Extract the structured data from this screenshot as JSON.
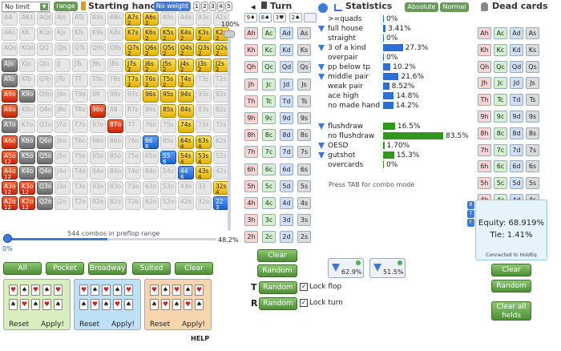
{
  "header": {
    "limit_select": "No limit",
    "range_label": "range",
    "starting_hand": "Starting hand",
    "no_weight": "No weight",
    "tabs": [
      "1",
      "2",
      "3",
      "4",
      "5"
    ],
    "turn": "Turn",
    "statistics": "Statistics",
    "absolute": "Absolute",
    "normal": "Normal",
    "dead_cards": "Dead cards"
  },
  "range": {
    "percent": "100%",
    "combos": "544 combos in preflop range",
    "slider_value": "48.2%",
    "slider_start": "0%",
    "rows": [
      [
        [
          "AA",
          "",
          "g"
        ],
        [
          "AKs",
          "",
          "g"
        ],
        [
          "AQs",
          "",
          "g"
        ],
        [
          "AJs",
          "",
          "g"
        ],
        [
          "ATs",
          "",
          "g"
        ],
        [
          "A9s",
          "",
          "g"
        ],
        [
          "A8s",
          "",
          "g"
        ],
        [
          "A7s",
          "2",
          "y"
        ],
        [
          "A6s",
          "2",
          "y"
        ],
        [
          "A5s",
          "",
          "g"
        ],
        [
          "A4s",
          "",
          "g"
        ],
        [
          "A3s",
          "",
          "g"
        ],
        [
          "A2s",
          "",
          "g"
        ]
      ],
      [
        [
          "AKo",
          "",
          "g"
        ],
        [
          "KK",
          "",
          "g"
        ],
        [
          "KQs",
          "",
          "g"
        ],
        [
          "KJs",
          "",
          "g"
        ],
        [
          "KTs",
          "",
          "g"
        ],
        [
          "K9s",
          "",
          "g"
        ],
        [
          "K8s",
          "",
          "g"
        ],
        [
          "K7s",
          "",
          "y"
        ],
        [
          "K6s",
          "2",
          "y"
        ],
        [
          "K5s",
          "2",
          "y"
        ],
        [
          "K4s",
          "2",
          "y"
        ],
        [
          "K3s",
          "2",
          "y"
        ],
        [
          "K2s",
          "2",
          "y"
        ]
      ],
      [
        [
          "AQo",
          "",
          "g"
        ],
        [
          "KQo",
          "",
          "g"
        ],
        [
          "QQ",
          "",
          "g"
        ],
        [
          "QJs",
          "",
          "g"
        ],
        [
          "QTs",
          "",
          "g"
        ],
        [
          "Q9s",
          "",
          "g"
        ],
        [
          "Q8s",
          "",
          "g"
        ],
        [
          "Q7s",
          "2",
          "y"
        ],
        [
          "Q6s",
          "2",
          "y"
        ],
        [
          "Q5s",
          "2",
          "y"
        ],
        [
          "Q4s",
          "2",
          "y"
        ],
        [
          "Q3s",
          "2",
          "y"
        ],
        [
          "Q2s",
          "2",
          "y"
        ]
      ],
      [
        [
          "AJo",
          "",
          "d"
        ],
        [
          "KJo",
          "",
          "g"
        ],
        [
          "QJo",
          "",
          "g"
        ],
        [
          "JJ",
          "",
          "g"
        ],
        [
          "JTs",
          "",
          "g"
        ],
        [
          "J9s",
          "",
          "g"
        ],
        [
          "J8s",
          "",
          "g"
        ],
        [
          "J7s",
          "2",
          "y"
        ],
        [
          "J6s",
          "2",
          "y"
        ],
        [
          "J5s",
          "2",
          "y"
        ],
        [
          "J4s",
          "2",
          "y"
        ],
        [
          "J3s",
          "2",
          "y"
        ],
        [
          "J2s",
          "2",
          "y"
        ]
      ],
      [
        [
          "ATo",
          "",
          "d"
        ],
        [
          "KTo",
          "",
          "g"
        ],
        [
          "QTo",
          "",
          "g"
        ],
        [
          "JTo",
          "",
          "g"
        ],
        [
          "TT",
          "",
          "g"
        ],
        [
          "T9s",
          "",
          "g"
        ],
        [
          "T8s",
          "",
          "g"
        ],
        [
          "T7s",
          "2",
          "y"
        ],
        [
          "T6s",
          "2",
          "y"
        ],
        [
          "T5s",
          "2",
          "y"
        ],
        [
          "T4s",
          "2",
          "y"
        ],
        [
          "T3s",
          "",
          "g"
        ],
        [
          "T2s",
          "",
          "g"
        ]
      ],
      [
        [
          "A9o",
          "",
          "r"
        ],
        [
          "K9o",
          "",
          "d"
        ],
        [
          "Q9o",
          "",
          "g"
        ],
        [
          "J9o",
          "",
          "g"
        ],
        [
          "T9o",
          "",
          "g"
        ],
        [
          "99",
          "",
          "g"
        ],
        [
          "98s",
          "",
          "g"
        ],
        [
          "97s",
          "",
          "g"
        ],
        [
          "96s",
          "",
          "y"
        ],
        [
          "95s",
          "",
          "y"
        ],
        [
          "94s",
          "",
          "y"
        ],
        [
          "93s",
          "",
          "g"
        ],
        [
          "92s",
          "",
          "g"
        ]
      ],
      [
        [
          "A8o",
          "",
          "r"
        ],
        [
          "K8o",
          "",
          "g"
        ],
        [
          "Q8o",
          "",
          "g"
        ],
        [
          "J8o",
          "",
          "g"
        ],
        [
          "T8o",
          "",
          "g"
        ],
        [
          "98o",
          "",
          "r"
        ],
        [
          "88",
          "",
          "g"
        ],
        [
          "87s",
          "",
          "g"
        ],
        [
          "86s",
          "",
          "g"
        ],
        [
          "85s",
          "",
          "y"
        ],
        [
          "84s",
          "",
          "y"
        ],
        [
          "83s",
          "",
          "g"
        ],
        [
          "82s",
          "",
          "g"
        ]
      ],
      [
        [
          "A7o",
          "",
          "d"
        ],
        [
          "K7o",
          "",
          "g"
        ],
        [
          "Q7o",
          "",
          "g"
        ],
        [
          "J7o",
          "",
          "g"
        ],
        [
          "T7o",
          "",
          "g"
        ],
        [
          "97o",
          "",
          "g"
        ],
        [
          "87o",
          "",
          "r"
        ],
        [
          "77",
          "",
          "g"
        ],
        [
          "76s",
          "",
          "g"
        ],
        [
          "75s",
          "",
          "g"
        ],
        [
          "74s",
          "",
          "y"
        ],
        [
          "73s",
          "",
          "g"
        ],
        [
          "72s",
          "",
          "g"
        ]
      ],
      [
        [
          "A6o",
          "",
          "r"
        ],
        [
          "K6o",
          "",
          "d"
        ],
        [
          "Q6o",
          "",
          "d"
        ],
        [
          "J6o",
          "",
          "g"
        ],
        [
          "T6o",
          "",
          "g"
        ],
        [
          "96o",
          "",
          "g"
        ],
        [
          "86o",
          "",
          "g"
        ],
        [
          "76o",
          "",
          "g"
        ],
        [
          "66",
          "6",
          "b"
        ],
        [
          "65s",
          "",
          "g"
        ],
        [
          "64s",
          "4",
          "y"
        ],
        [
          "63s",
          "4",
          "y"
        ],
        [
          "62s",
          "",
          "g"
        ]
      ],
      [
        [
          "A5o",
          "12",
          "r"
        ],
        [
          "K5o",
          "",
          "d"
        ],
        [
          "Q5o",
          "",
          "d"
        ],
        [
          "J5o",
          "",
          "g"
        ],
        [
          "T5o",
          "",
          "g"
        ],
        [
          "95o",
          "",
          "g"
        ],
        [
          "85o",
          "",
          "g"
        ],
        [
          "75o",
          "",
          "g"
        ],
        [
          "65o",
          "",
          "g"
        ],
        [
          "55",
          "6",
          "b"
        ],
        [
          "54s",
          "4",
          "y"
        ],
        [
          "53s",
          "4",
          "y"
        ],
        [
          "52s",
          "",
          "g"
        ]
      ],
      [
        [
          "A4o",
          "12",
          "r"
        ],
        [
          "K4o",
          "",
          "d"
        ],
        [
          "Q4o",
          "",
          "d"
        ],
        [
          "J4o",
          "",
          "g"
        ],
        [
          "T4o",
          "",
          "g"
        ],
        [
          "94o",
          "",
          "g"
        ],
        [
          "84o",
          "",
          "g"
        ],
        [
          "74o",
          "",
          "g"
        ],
        [
          "64o",
          "",
          "g"
        ],
        [
          "54o",
          "",
          "g"
        ],
        [
          "44",
          "6",
          "b"
        ],
        [
          "43s",
          "4",
          "y"
        ],
        [
          "42s",
          "",
          "g"
        ]
      ],
      [
        [
          "A3o",
          "12",
          "r"
        ],
        [
          "K3o",
          "12",
          "r"
        ],
        [
          "Q3o",
          "",
          "d"
        ],
        [
          "J3o",
          "",
          "g"
        ],
        [
          "T3o",
          "",
          "g"
        ],
        [
          "93o",
          "",
          "g"
        ],
        [
          "83o",
          "",
          "g"
        ],
        [
          "73o",
          "",
          "g"
        ],
        [
          "63o",
          "",
          "g"
        ],
        [
          "53o",
          "",
          "g"
        ],
        [
          "43o",
          "",
          "g"
        ],
        [
          "33",
          "",
          "g"
        ],
        [
          "32s",
          "4",
          "y"
        ]
      ],
      [
        [
          "A2o",
          "12",
          "r"
        ],
        [
          "K2o",
          "12",
          "r"
        ],
        [
          "Q2o",
          "",
          "d"
        ],
        [
          "J2o",
          "",
          "g"
        ],
        [
          "T2o",
          "",
          "g"
        ],
        [
          "92o",
          "",
          "g"
        ],
        [
          "82o",
          "",
          "g"
        ],
        [
          "72o",
          "",
          "g"
        ],
        [
          "62o",
          "",
          "g"
        ],
        [
          "52o",
          "",
          "g"
        ],
        [
          "42o",
          "",
          "g"
        ],
        [
          "32o",
          "",
          "g"
        ],
        [
          "22",
          "3",
          "b"
        ]
      ]
    ]
  },
  "range_buttons": [
    "All",
    "Pocket",
    "Broadway",
    "Suited",
    "Clear"
  ],
  "presets": [
    {
      "reset": "Reset",
      "apply": "Apply!",
      "color": "#d8eebe"
    },
    {
      "reset": "Reset",
      "apply": "Apply!",
      "color": "#bde0f6"
    },
    {
      "reset": "Reset",
      "apply": "Apply!",
      "color": "#f7d6ae"
    }
  ],
  "help": "HELP",
  "board": {
    "flop": [
      "9♦",
      "8♠",
      "3♥"
    ],
    "turn": "2♠"
  },
  "turn_cards": [
    [
      "Ah",
      "Ac",
      "Ad",
      "As"
    ],
    [
      "Kh",
      "Kc",
      "Kd",
      "Ks"
    ],
    [
      "Qh",
      "Qc",
      "Qd",
      "Qs"
    ],
    [
      "Jh",
      "Jc",
      "Jd",
      "Js"
    ],
    [
      "Th",
      "Tc",
      "Td",
      "Ts"
    ],
    [
      "9h",
      "9c",
      "9d",
      "9s"
    ],
    [
      "8h",
      "8c",
      "8d",
      "8s"
    ],
    [
      "7h",
      "7c",
      "7d",
      "7s"
    ],
    [
      "6h",
      "6c",
      "6d",
      "6s"
    ],
    [
      "5h",
      "5c",
      "5d",
      "5s"
    ],
    [
      "4h",
      "4c",
      "4d",
      "4s"
    ],
    [
      "3h",
      "3c",
      "3d",
      "3s"
    ],
    [
      "2h",
      "2c",
      "2d",
      "2s"
    ]
  ],
  "turn_buttons": {
    "clear": "Clear",
    "random": "Random",
    "random_flop": "Random",
    "random_turn": "Random",
    "lock_flop": "Lock flop",
    "lock_turn": "Lock turn"
  },
  "stats": [
    {
      "label": ">=quads",
      "value": "0%",
      "pct": 0,
      "arrow": false,
      "color": "#2a6fd6"
    },
    {
      "label": "full house",
      "value": "3.41%",
      "pct": 3.41,
      "arrow": true,
      "color": "#2a6fd6"
    },
    {
      "label": "straight",
      "value": "0%",
      "pct": 0,
      "arrow": false,
      "color": "#2a6fd6"
    },
    {
      "label": "3 of a kind",
      "value": "27.3%",
      "pct": 27.3,
      "arrow": true,
      "color": "#2a6fd6"
    },
    {
      "label": "overpair",
      "value": "0%",
      "pct": 0,
      "arrow": false,
      "color": "#2a6fd6"
    },
    {
      "label": "pp below tp",
      "value": "10.2%",
      "pct": 10.2,
      "arrow": true,
      "color": "#2a6fd6"
    },
    {
      "label": "middle pair",
      "value": "21.6%",
      "pct": 21.6,
      "arrow": true,
      "color": "#2a6fd6"
    },
    {
      "label": "weak pair",
      "value": "8.52%",
      "pct": 8.52,
      "arrow": false,
      "color": "#2a6fd6"
    },
    {
      "label": "ace high",
      "value": "14.8%",
      "pct": 14.8,
      "arrow": false,
      "color": "#2a6fd6"
    },
    {
      "label": "no made hand",
      "value": "14.2%",
      "pct": 14.2,
      "arrow": false,
      "color": "#2a6fd6"
    },
    {
      "label": "flushdraw",
      "value": "16.5%",
      "pct": 16.5,
      "arrow": true,
      "color": "#2e9a1a"
    },
    {
      "label": "no flushdraw",
      "value": "83.5%",
      "pct": 83.5,
      "arrow": false,
      "color": "#2e9a1a"
    },
    {
      "label": "OESD",
      "value": "1.70%",
      "pct": 1.7,
      "arrow": true,
      "color": "#2e9a1a"
    },
    {
      "label": "gutshot",
      "value": "15.3%",
      "pct": 15.3,
      "arrow": true,
      "color": "#2e9a1a"
    },
    {
      "label": "overcards",
      "value": "0%",
      "pct": 0,
      "arrow": false,
      "color": "#2e9a1a"
    }
  ],
  "stats_hint": "Press TAB for combo mode",
  "filters": [
    {
      "value": "62.9%"
    },
    {
      "value": "51.5%"
    }
  ],
  "dead_cards": [
    [
      "Ah",
      "Ac",
      "Ad",
      "As"
    ],
    [
      "Kh",
      "Kc",
      "Kd",
      "Ks"
    ],
    [
      "Qh",
      "Qc",
      "Qd",
      "Qs"
    ],
    [
      "Jh",
      "Jc",
      "Jd",
      "Js"
    ],
    [
      "Th",
      "Tc",
      "Td",
      "Ts"
    ],
    [
      "9h",
      "9c",
      "9d",
      "9s"
    ],
    [
      "8h",
      "8c",
      "8d",
      "8s"
    ],
    [
      "7h",
      "7c",
      "7d",
      "7s"
    ],
    [
      "6h",
      "6c",
      "6d",
      "6s"
    ],
    [
      "5h",
      "5c",
      "5d",
      "5s"
    ],
    [
      "4h",
      "4c",
      "4d",
      "4s"
    ],
    [
      "3h",
      "3c",
      "3d",
      "3s"
    ],
    [
      "2h",
      "2c",
      "2d",
      "2s"
    ]
  ],
  "equity": {
    "equity": "Equity: 68.919%",
    "tie": "Tie: 1.41%",
    "connected": "Connected to HoldEq",
    "side_tabs": [
      "R",
      "T",
      "F"
    ]
  },
  "dead_buttons": {
    "clear": "Clear",
    "random": "Random",
    "clear_all": "Clear all fields"
  },
  "colors": {
    "heart": "#fbd4d4",
    "club": "#d4f2d0",
    "diamond": "#cfe0f8",
    "spade": "#dcdcdc",
    "accent": "#6a9a5a"
  }
}
